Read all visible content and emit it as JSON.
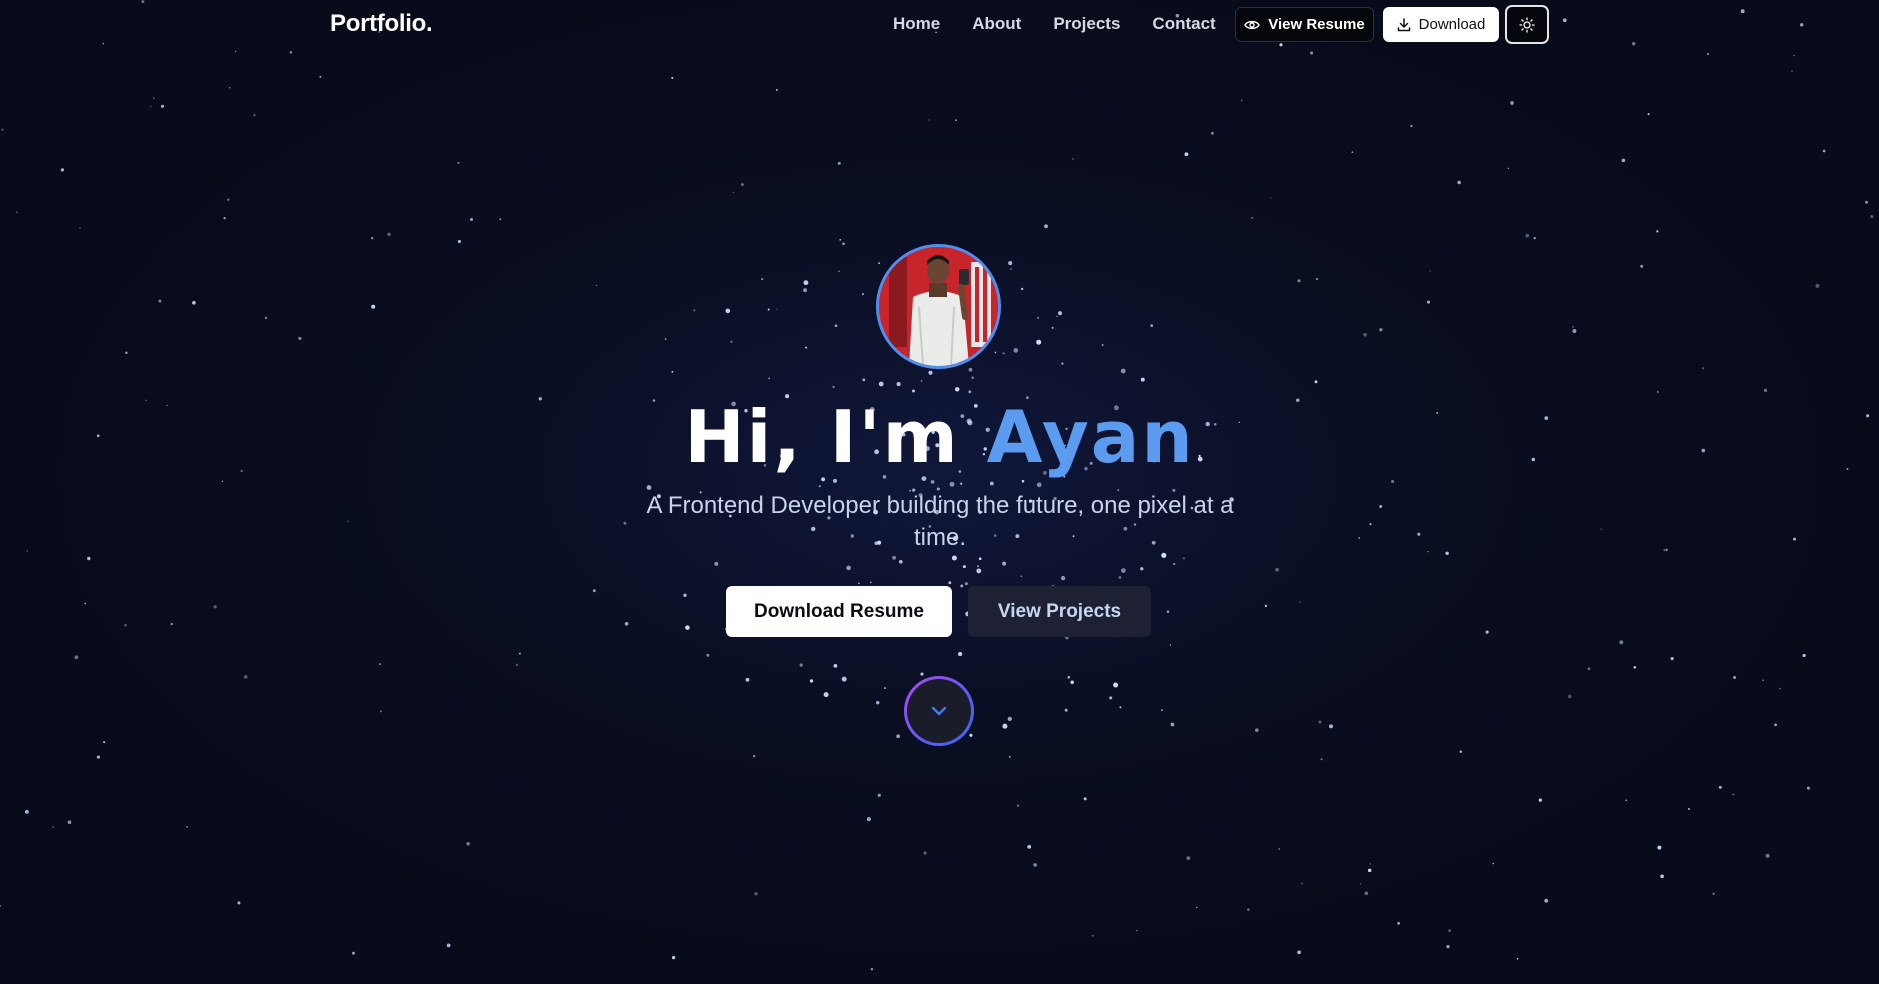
{
  "nav": {
    "logo": "Portfolio.",
    "links": [
      "Home",
      "About",
      "Projects",
      "Contact"
    ],
    "view_resume_label": "View Resume",
    "download_label": "Download",
    "theme_icon": "sun-icon"
  },
  "hero": {
    "greeting": "Hi, I'm",
    "name": "Ayan",
    "subtitle": "A Frontend Developer building the future, one pixel at a time.",
    "primary_button": "Download Resume",
    "secondary_button": "View Projects",
    "scroll_icon": "chevron-down-icon"
  },
  "colors": {
    "background": "#080b1a",
    "accent": "#5b9cf0",
    "star": "#cfe0ff"
  }
}
